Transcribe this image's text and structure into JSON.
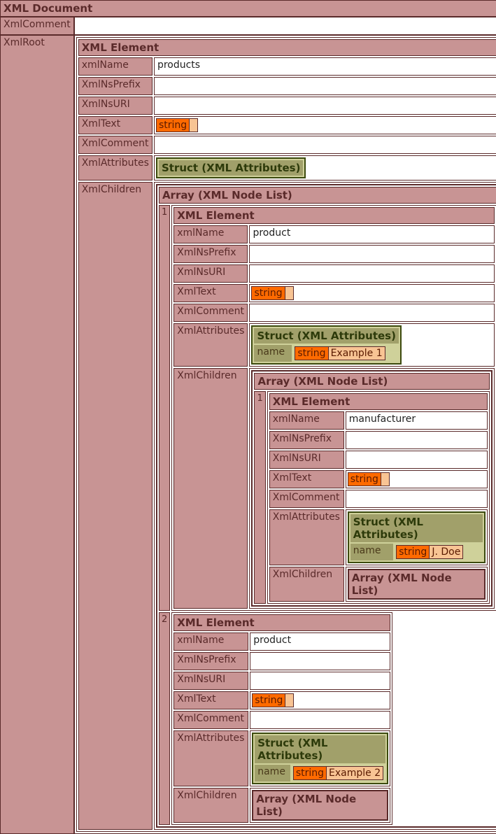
{
  "document": {
    "title": "XML Document",
    "comment_label": "XmlComment",
    "root_label": "XmlRoot"
  },
  "labels": {
    "element_title": "XML Element",
    "xmlName": "xmlName",
    "nsPrefix": "XmlNsPrefix",
    "nsURI": "XmlNsURI",
    "text": "XmlText",
    "comment": "XmlComment",
    "attributes": "XmlAttributes",
    "children": "XmlChildren",
    "struct_title": "Struct (XML Attributes)",
    "array_title": "Array (XML Node List)",
    "string_type": "string",
    "attr_name_key": "name"
  },
  "root": {
    "xmlName": "products",
    "children": [
      {
        "index": "1",
        "xmlName": "product",
        "attr_name": "Example 1",
        "children": [
          {
            "index": "1",
            "xmlName": "manufacturer",
            "attr_name": "J. Doe"
          }
        ]
      },
      {
        "index": "2",
        "xmlName": "product",
        "attr_name": "Example 2"
      }
    ]
  },
  "colors": {
    "header_bg": "#c89494",
    "border": "#5a2a2a",
    "struct_bg": "#a1a06a",
    "string_type_bg": "#ff6a00",
    "string_value_bg": "#f8c494"
  }
}
